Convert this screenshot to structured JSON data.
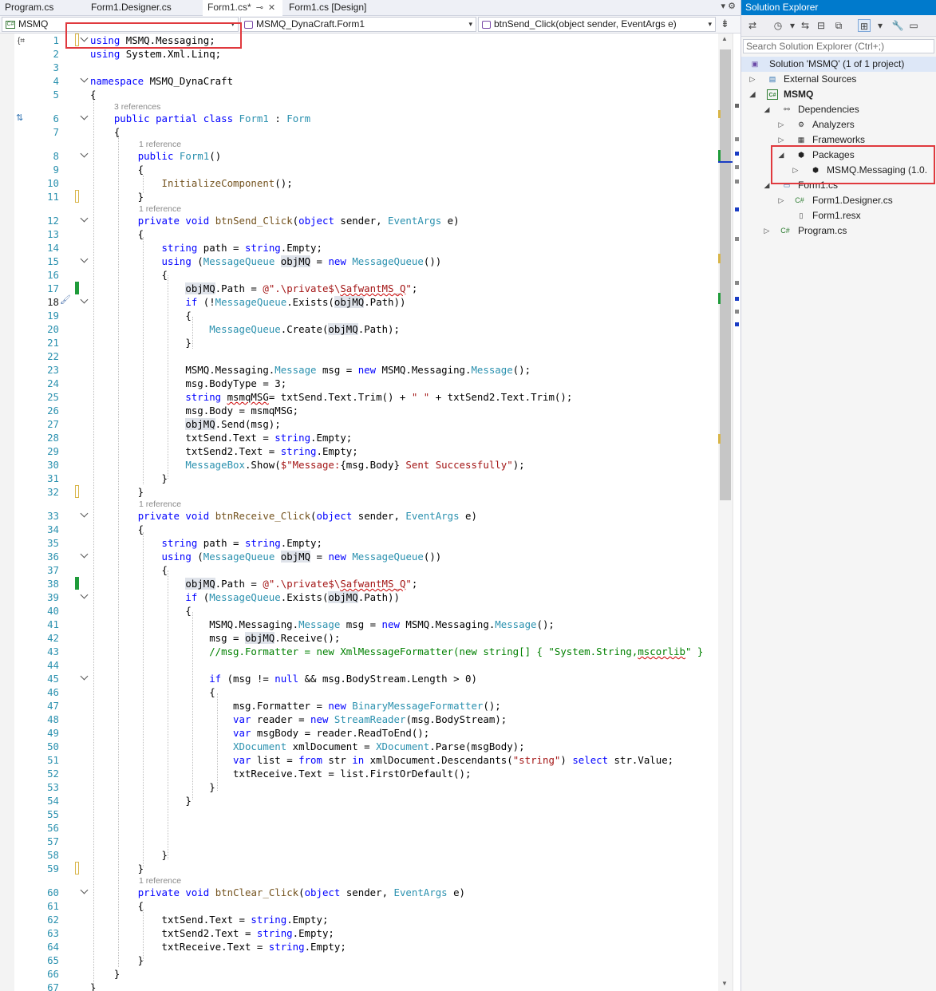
{
  "tabs": [
    {
      "label": "Program.cs"
    },
    {
      "label": "Form1.Designer.cs"
    },
    {
      "label": "Form1.cs*",
      "pin": "⊸",
      "close": "✕"
    },
    {
      "label": "Form1.cs [Design]"
    }
  ],
  "tab_overflow": "▾ ⚙",
  "navbar": {
    "project": "MSMQ",
    "class": "MSMQ_DynaCraft.Form1",
    "member": "btnSend_Click(object sender, EventArgs e)"
  },
  "editor": {
    "ref_3": "3 references",
    "ref_1": "1 reference",
    "line_numbers": [
      "1",
      "2",
      "3",
      "4",
      "5",
      "6",
      "7",
      "8",
      "9",
      "10",
      "11",
      "12",
      "13",
      "14",
      "15",
      "16",
      "17",
      "18",
      "19",
      "20",
      "21",
      "22",
      "23",
      "24",
      "25",
      "26",
      "27",
      "28",
      "29",
      "30",
      "31",
      "32",
      "33",
      "34",
      "35",
      "36",
      "37",
      "38",
      "39",
      "40",
      "41",
      "42",
      "43",
      "44",
      "45",
      "46",
      "47",
      "48",
      "49",
      "50",
      "51",
      "52",
      "53",
      "54",
      "55",
      "56",
      "57",
      "58",
      "59",
      "60",
      "61",
      "62",
      "63",
      "64",
      "65",
      "66",
      "67"
    ]
  },
  "solution_explorer": {
    "title": "Solution Explorer",
    "search_placeholder": "Search Solution Explorer (Ctrl+;)",
    "solution": "Solution 'MSMQ' (1 of 1 project)",
    "external_sources": "External Sources",
    "project": "MSMQ",
    "dependencies": "Dependencies",
    "analyzers": "Analyzers",
    "frameworks": "Frameworks",
    "packages": "Packages",
    "msmq_package": "MSMQ.Messaging (1.0.",
    "form1_cs": "Form1.cs",
    "form1_designer": "Form1.Designer.cs",
    "form1_resx": "Form1.resx",
    "program_cs": "Program.cs"
  },
  "colors": {
    "keyword": "#0000ff",
    "type": "#2b91af",
    "string": "#a31515",
    "comment": "#008000",
    "accent": "#007acc",
    "annotation_box": "#e0393e"
  }
}
